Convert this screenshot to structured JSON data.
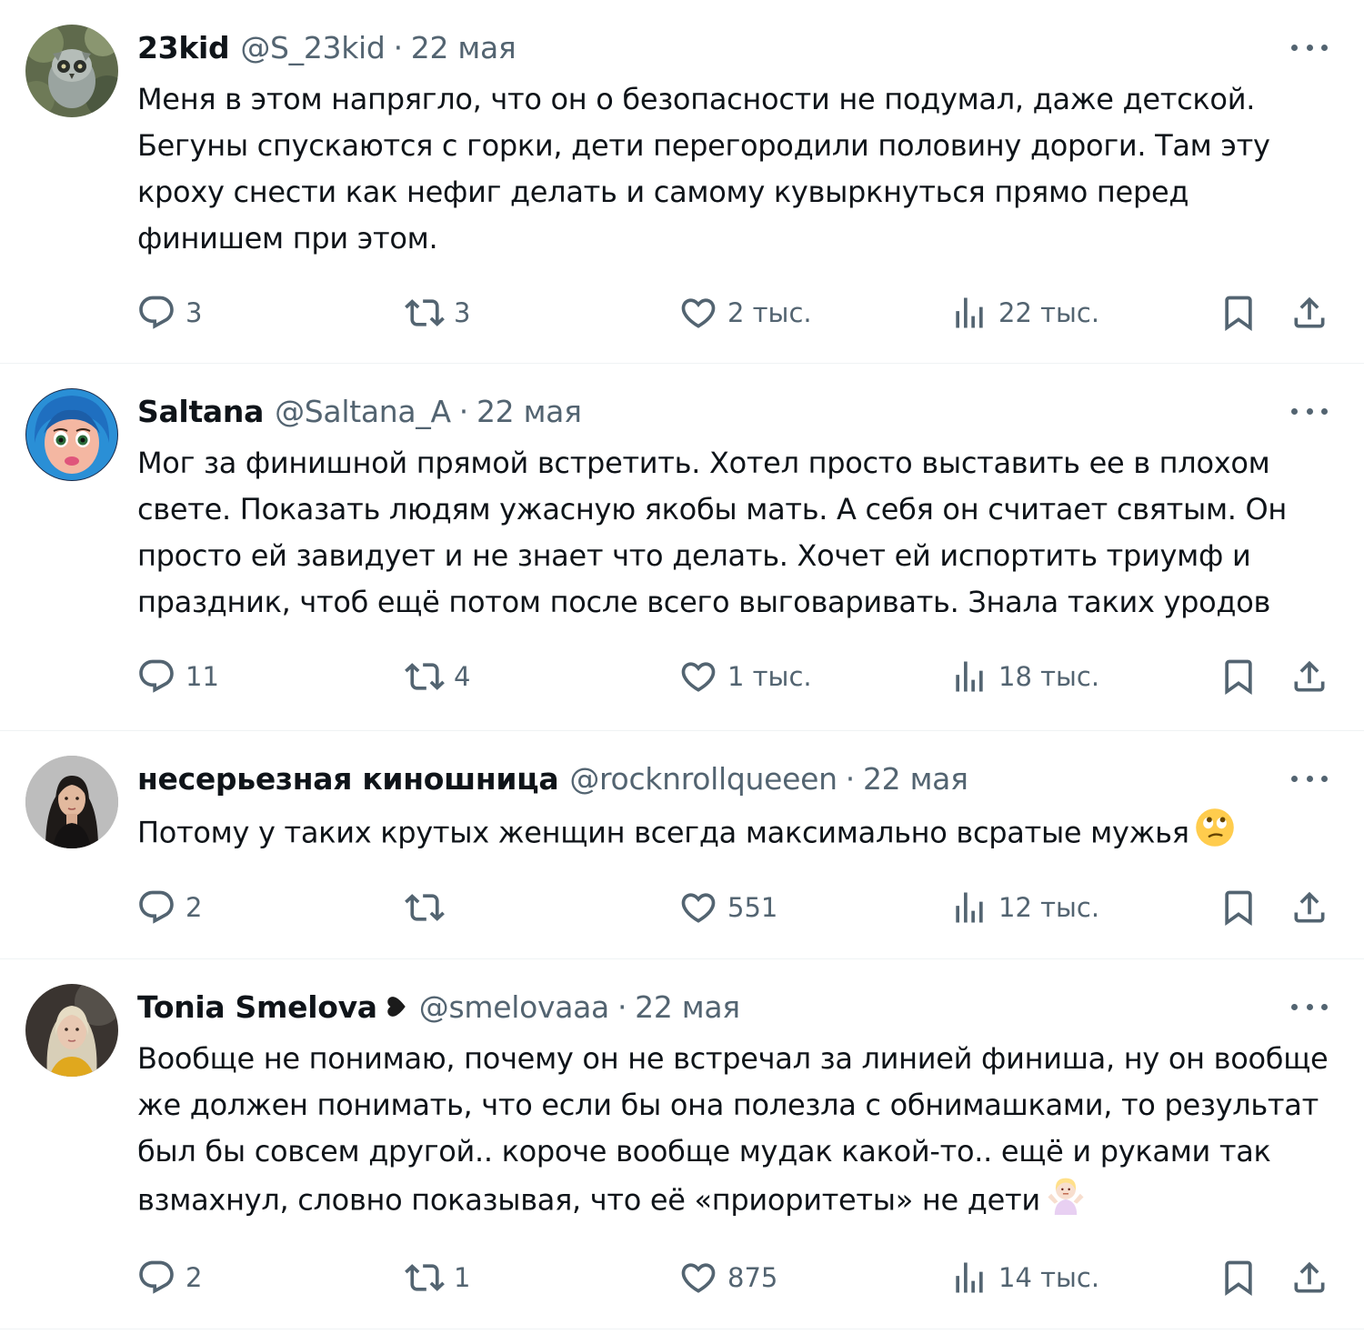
{
  "tweets": [
    {
      "name": "23kid",
      "handle": "@S_23kid",
      "sep": "·",
      "date": "22 мая",
      "text": "Меня в этом напрягло, что он о безопасности не подумал, даже детской. Бегуны спускаются с горки, дети перегородили половину дороги. Там эту кроху снести как нефиг делать и самому кувыркнуться прямо перед финишем при этом.",
      "replies": "3",
      "retweets": "3",
      "likes": "2 тыс.",
      "views": "22 тыс."
    },
    {
      "name": "Saltana",
      "handle": "@Saltana_A",
      "sep": "·",
      "date": "22 мая",
      "text": "Мог за финишной прямой встретить. Хотел просто выставить ее в плохом свете. Показать людям ужасную якобы мать. А себя он считает святым. Он просто ей завидует и не знает что делать. Хочет ей испортить триумф и праздник, чтоб ещё потом после всего выговаривать. Знала таких уродов",
      "replies": "11",
      "retweets": "4",
      "likes": "1 тыс.",
      "views": "18 тыс."
    },
    {
      "name": "несерьезная киношница",
      "handle": "@rocknrollqueeen",
      "sep": "·",
      "date": "22 мая",
      "text": "Потому у таких крутых женщин всегда максимально всратые мужья",
      "replies": "2",
      "retweets": "",
      "likes": "551",
      "views": "12 тыс."
    },
    {
      "name": "Tonia Smelova",
      "handle": "@smelovaaa",
      "sep": "·",
      "date": "22 мая",
      "text": "Вообще не понимаю, почему он не встречал за линией финиша, ну он вообще же должен понимать, что если бы она полезла с обнимашками, то результат был бы совсем другой.. короче вообще мудак какой-то.. ещё и руками так взмахнул, словно показывая, что её «приоритеты» не дети",
      "replies": "2",
      "retweets": "1",
      "likes": "875",
      "views": "14 тыс."
    }
  ],
  "colors": {
    "text": "#0f1419",
    "secondary": "#536471",
    "divider": "#eff3f4"
  },
  "icons": [
    "reply-icon",
    "retweet-icon",
    "like-icon",
    "views-icon",
    "bookmark-icon",
    "share-icon",
    "more-icon",
    "eye-roll-emoji",
    "shrug-emoji",
    "black-heart-badge"
  ]
}
